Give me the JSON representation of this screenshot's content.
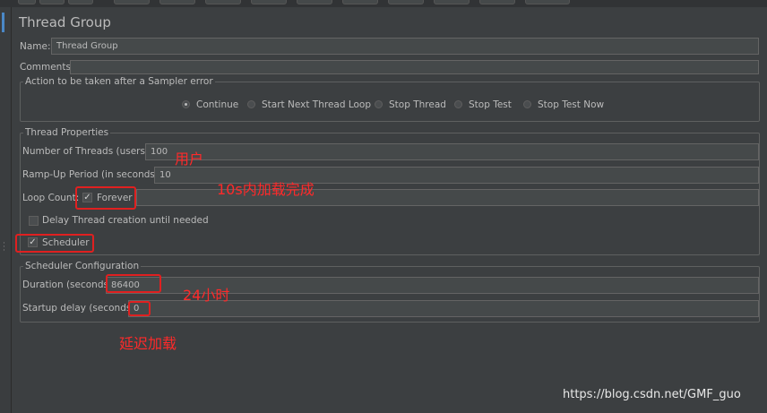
{
  "panel": {
    "title": "Thread Group"
  },
  "name_row": {
    "label": "Name:",
    "value": "Thread Group"
  },
  "comments_row": {
    "label": "Comments:",
    "value": ""
  },
  "sampler_error": {
    "legend": "Action to be taken after a Sampler error",
    "options": [
      "Continue",
      "Start Next Thread Loop",
      "Stop Thread",
      "Stop Test",
      "Stop Test Now"
    ],
    "selected": "Continue"
  },
  "thread_properties": {
    "legend": "Thread Properties",
    "threads_label": "Number of Threads (users):",
    "threads_value": "100",
    "rampup_label": "Ramp-Up Period (in seconds):",
    "rampup_value": "10",
    "loop_label": "Loop Count:",
    "forever_label": "Forever",
    "forever_checked": true,
    "delay_label": "Delay Thread creation until needed",
    "delay_checked": false,
    "scheduler_label": "Scheduler",
    "scheduler_checked": true
  },
  "scheduler_config": {
    "legend": "Scheduler Configuration",
    "duration_label": "Duration (seconds)",
    "duration_value": "86400",
    "startup_label": "Startup delay (seconds)",
    "startup_value": "0"
  },
  "annotations": {
    "users": "用户",
    "rampup": "10s内加载完成",
    "duration": "24小时",
    "startup": "延迟加载",
    "color": "#ff2a2a"
  },
  "watermark": "https://blog.csdn.net/GMF_guo",
  "colors": {
    "background": "#3c3f41",
    "field": "#45494a",
    "text": "#bbbbbb",
    "highlight": "#e02020"
  }
}
